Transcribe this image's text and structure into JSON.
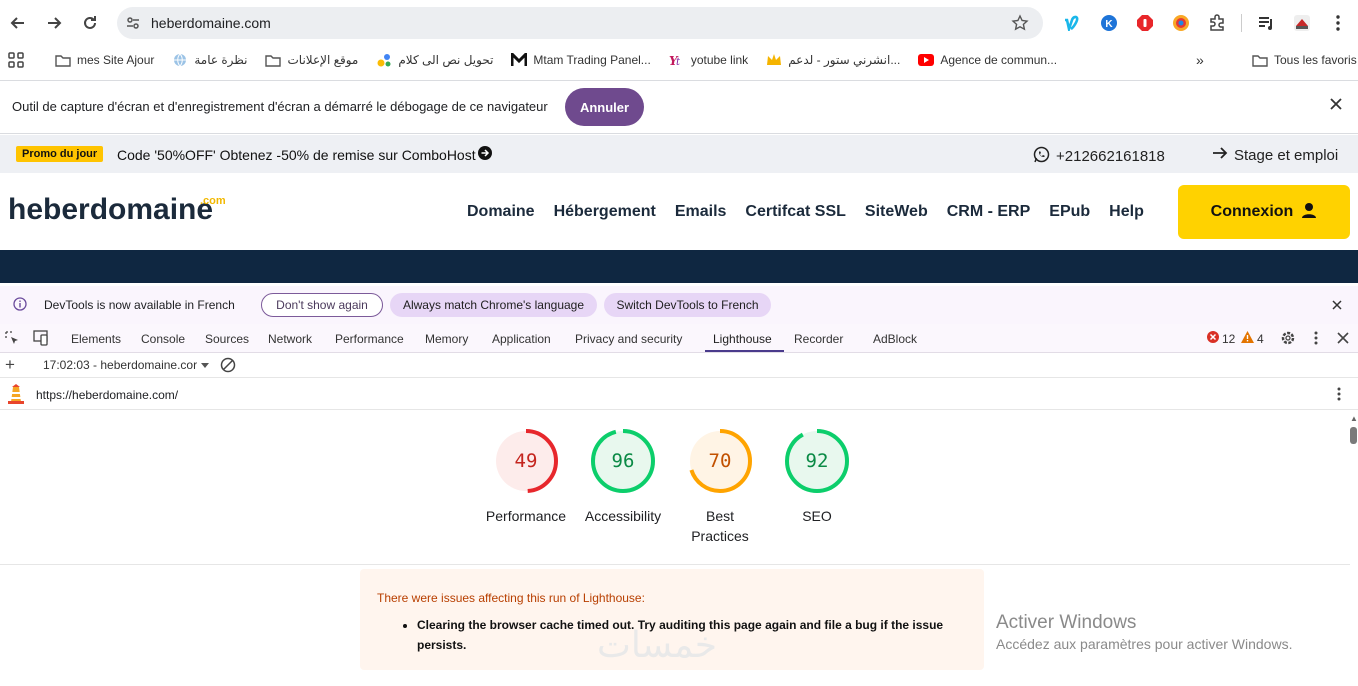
{
  "browser": {
    "url": "heberdomaine.com",
    "bookmarks": [
      {
        "label": "mes Site Ajour",
        "icon": "folder-icon"
      },
      {
        "label": "نظرة عامة",
        "icon": "globe-icon"
      },
      {
        "label": "موقع الإعلانات",
        "icon": "folder-icon"
      },
      {
        "label": "تحويل نص الى كلام",
        "icon": "dots-icon"
      },
      {
        "label": "Mtam Trading Panel...",
        "icon": "m-logo-icon"
      },
      {
        "label": "yotube link",
        "icon": "yt-logo-icon"
      },
      {
        "label": "انشرني ستور - لدعم...",
        "icon": "crown-icon"
      },
      {
        "label": "Agence de commun...",
        "icon": "youtube-icon"
      }
    ],
    "more_label": "»",
    "all_bookmarks_label": "Tous les favoris"
  },
  "infobar": {
    "message": "Outil de capture d'écran et d'enregistrement d'écran a démarré le débogage de ce navigateur",
    "cancel_label": "Annuler"
  },
  "site": {
    "promo_badge": "Promo du jour",
    "promo_text": "Code '50%OFF' Obtenez -50% de remise sur ComboHost",
    "phone": "+212662161818",
    "stage": "Stage et emploi",
    "logo": "heberdomaine",
    "logo_suffix": ".com",
    "nav": [
      "Domaine",
      "Hébergement",
      "Emails",
      "Certifcat SSL",
      "SiteWeb",
      "CRM - ERP",
      "EPub",
      "Help"
    ],
    "login_label": "Connexion"
  },
  "devtools": {
    "notice": "DevTools is now available in French",
    "dont_show": "Don't show again",
    "match_language": "Always match Chrome's language",
    "switch_french": "Switch DevTools to French",
    "tabs": [
      "Elements",
      "Console",
      "Sources",
      "Network",
      "Performance",
      "Memory",
      "Application",
      "Privacy and security",
      "Lighthouse",
      "Recorder",
      "AdBlock"
    ],
    "active_tab": "Lighthouse",
    "errors": "12",
    "warnings": "4",
    "run_label": "17:02:03 - heberdomaine.cor",
    "audited_url": "https://heberdomaine.com/"
  },
  "lighthouse": {
    "scores": [
      {
        "label": "Performance",
        "value": 49,
        "color": "#e7272c",
        "bg": "#fdeceb",
        "text_color": "#c4251e"
      },
      {
        "label": "Accessibility",
        "value": 96,
        "color": "#0cce6b",
        "bg": "#e8f8ee",
        "text_color": "#0a8a45"
      },
      {
        "label": "Best Practices",
        "value": 70,
        "color": "#ffa400",
        "bg": "#fff4e5",
        "text_color": "#c25100"
      },
      {
        "label": "SEO",
        "value": 92,
        "color": "#0cce6b",
        "bg": "#e8f8ee",
        "text_color": "#0a8a45"
      }
    ],
    "issues_heading": "There were issues affecting this run of Lighthouse:",
    "issues": [
      "Clearing the browser cache timed out. Try auditing this page again and file a bug if the issue persists."
    ]
  },
  "windows": {
    "activate_title": "Activer Windows",
    "activate_sub": "Accédez aux paramètres pour activer Windows."
  },
  "watermark": "خمسات"
}
